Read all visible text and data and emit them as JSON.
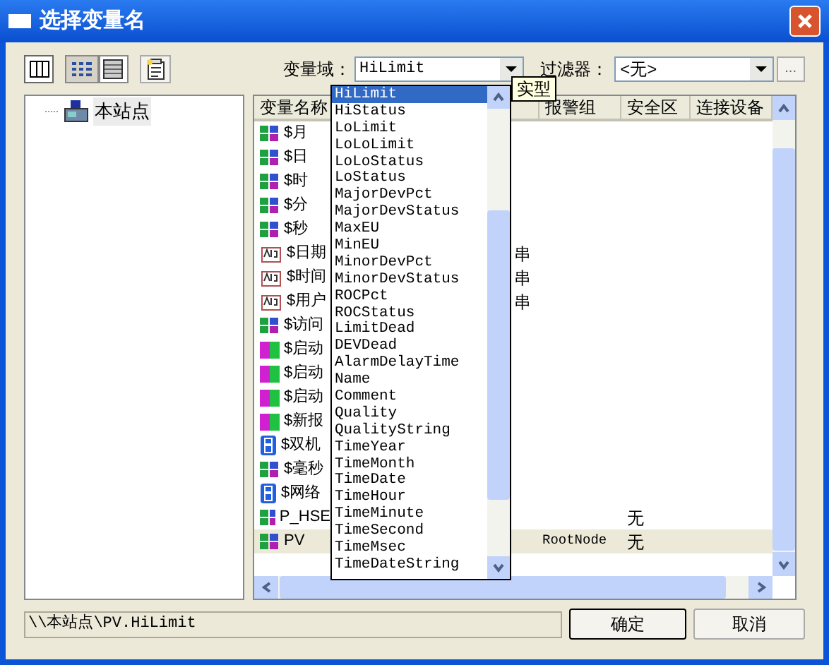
{
  "window": {
    "title": "选择变量名"
  },
  "domain": {
    "label": "变量域：",
    "value": "HiLimit"
  },
  "filter": {
    "label": "过滤器：",
    "value": "<无>",
    "browse": "..."
  },
  "tree": [
    {
      "label": "本站点"
    }
  ],
  "table": {
    "columns": [
      "变量名称",
      "报警组",
      "安全区",
      "连接设备"
    ],
    "rows": [
      {
        "kind": "grid",
        "name": "$月",
        "selected": false
      },
      {
        "kind": "grid",
        "name": "$日",
        "selected": false
      },
      {
        "kind": "grid",
        "name": "$时",
        "selected": false
      },
      {
        "kind": "grid",
        "name": "$分",
        "selected": false
      },
      {
        "kind": "grid",
        "name": "$秒",
        "selected": false
      },
      {
        "kind": "text",
        "name": "$日期",
        "column_2": "串",
        "selected": false
      },
      {
        "kind": "text",
        "name": "$时间",
        "column_2": "串",
        "selected": false
      },
      {
        "kind": "text",
        "name": "$用户",
        "column_2": "串",
        "selected": false
      },
      {
        "kind": "grid",
        "name": "$访问",
        "selected": false
      },
      {
        "kind": "counter",
        "name": "$启动",
        "selected": false
      },
      {
        "kind": "counter",
        "name": "$启动",
        "selected": false
      },
      {
        "kind": "counter",
        "name": "$启动",
        "selected": false
      },
      {
        "kind": "counter",
        "name": "$新报",
        "selected": false
      },
      {
        "kind": "digit",
        "name": "$双机",
        "selected": false
      },
      {
        "kind": "grid",
        "name": "$毫秒",
        "selected": false
      },
      {
        "kind": "digit",
        "name": "$网络",
        "selected": false
      },
      {
        "kind": "grid",
        "name": "P_HSE",
        "security_zone": "无",
        "selected": false
      },
      {
        "kind": "grid",
        "name": "PV",
        "alarm_group": "RootNode",
        "security_zone": "无",
        "selected": true
      }
    ]
  },
  "dropdown": {
    "items": [
      {
        "label": "HiLimit",
        "selected": true
      },
      {
        "label": "HiStatus",
        "selected": false
      },
      {
        "label": "LoLimit",
        "selected": false
      },
      {
        "label": "LoLoLimit",
        "selected": false
      },
      {
        "label": "LoLoStatus",
        "selected": false
      },
      {
        "label": "LoStatus",
        "selected": false
      },
      {
        "label": "MajorDevPct",
        "selected": false
      },
      {
        "label": "MajorDevStatus",
        "selected": false
      },
      {
        "label": "MaxEU",
        "selected": false
      },
      {
        "label": "MinEU",
        "selected": false
      },
      {
        "label": "MinorDevPct",
        "selected": false
      },
      {
        "label": "MinorDevStatus",
        "selected": false
      },
      {
        "label": "ROCPct",
        "selected": false
      },
      {
        "label": "ROCStatus",
        "selected": false
      },
      {
        "label": "LimitDead",
        "selected": false
      },
      {
        "label": "DEVDead",
        "selected": false
      },
      {
        "label": "AlarmDelayTime",
        "selected": false
      },
      {
        "label": "Name",
        "selected": false
      },
      {
        "label": "Comment",
        "selected": false
      },
      {
        "label": "Quality",
        "selected": false
      },
      {
        "label": "QualityString",
        "selected": false
      },
      {
        "label": "TimeYear",
        "selected": false
      },
      {
        "label": "TimeMonth",
        "selected": false
      },
      {
        "label": "TimeDate",
        "selected": false
      },
      {
        "label": "TimeHour",
        "selected": false
      },
      {
        "label": "TimeMinute",
        "selected": false
      },
      {
        "label": "TimeSecond",
        "selected": false
      },
      {
        "label": "TimeMsec",
        "selected": false
      },
      {
        "label": "TimeDateString",
        "selected": false
      }
    ]
  },
  "tooltip": "实型",
  "status_path": "\\\\本站点\\PV.HiLimit",
  "buttons": [
    "确定",
    "取消"
  ]
}
